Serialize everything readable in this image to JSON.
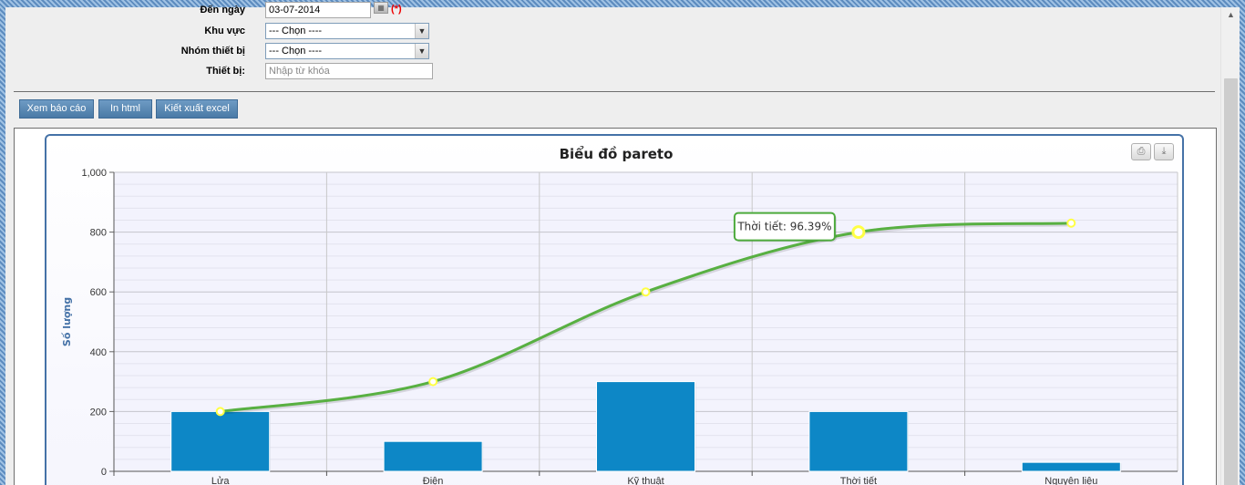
{
  "form": {
    "to_date": {
      "label": "Đến ngày",
      "value": "03-07-2014",
      "required": "(*)"
    },
    "region": {
      "label": "Khu vực",
      "selected": "--- Chọn ----"
    },
    "device_group": {
      "label": "Nhóm thiết bị",
      "selected": "--- Chọn ----"
    },
    "device": {
      "label": "Thiết bị:",
      "placeholder": "Nhập từ khóa"
    }
  },
  "buttons": {
    "view": "Xem báo cáo",
    "print_html": "In html",
    "export_excel": "Kiết xuất excel"
  },
  "toolbar_icons": [
    "print-icon",
    "download-icon"
  ],
  "tooltip": {
    "text": "Thời tiết: 96.39%",
    "border_color": "#4daa3c"
  },
  "colors": {
    "bar": "#0d87c6",
    "line": "#58b042",
    "marker": "#ffff44",
    "axis_title": "#4572a7"
  },
  "chart_data": {
    "type": "bar",
    "title": "Biểu đồ pareto",
    "ylabel": "Số lượng",
    "xlabel": "",
    "categories": [
      "Lửa",
      "Điện",
      "Kỹ thuật",
      "Thời tiết",
      "Nguyên liệu"
    ],
    "ylim": [
      0,
      1000
    ],
    "yticks": [
      "0",
      "200",
      "400",
      "600",
      "800",
      "1,000"
    ],
    "grid": true,
    "series": [
      {
        "type": "bar",
        "values": [
          200,
          100,
          300,
          200,
          30
        ]
      },
      {
        "type": "spline",
        "values": [
          200,
          300,
          600,
          800,
          830
        ]
      }
    ]
  }
}
